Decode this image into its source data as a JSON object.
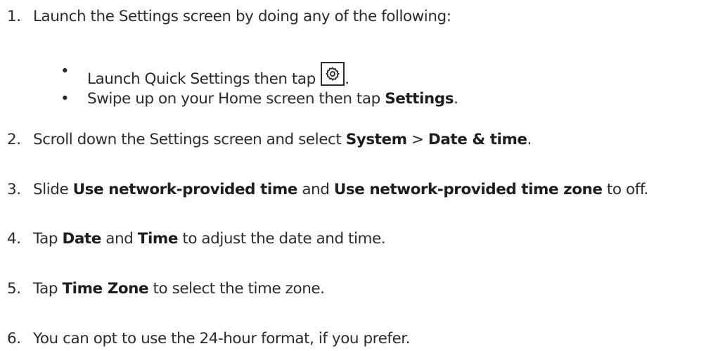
{
  "steps": [
    {
      "number": "1.",
      "text": "Launch the Settings screen by doing any of the following:",
      "substeps": [
        {
          "bullet": "•",
          "before": "Launch Quick Settings then tap",
          "icon": "gear-icon",
          "after": "."
        },
        {
          "bullet": "•",
          "before": "Swipe up on your Home screen then tap ",
          "bold": "Settings",
          "after": "."
        }
      ]
    },
    {
      "number": "2.",
      "before": "Scroll down the Settings screen and select ",
      "bold1": "System",
      "middle": " > ",
      "bold2": "Date & time",
      "after": "."
    },
    {
      "number": "3.",
      "before": "Slide ",
      "bold1": "Use network-provided time",
      "middle": " and ",
      "bold2": "Use network-provided time zone",
      "after": " to off."
    },
    {
      "number": "4.",
      "before": "Tap ",
      "bold1": "Date",
      "middle": " and ",
      "bold2": "Time",
      "after": " to adjust the date and time."
    },
    {
      "number": "5.",
      "before": "Tap ",
      "bold1": "Time Zone",
      "after": " to select the time zone."
    },
    {
      "number": "6.",
      "text": "You can opt to use the 24-hour format, if you prefer."
    }
  ]
}
